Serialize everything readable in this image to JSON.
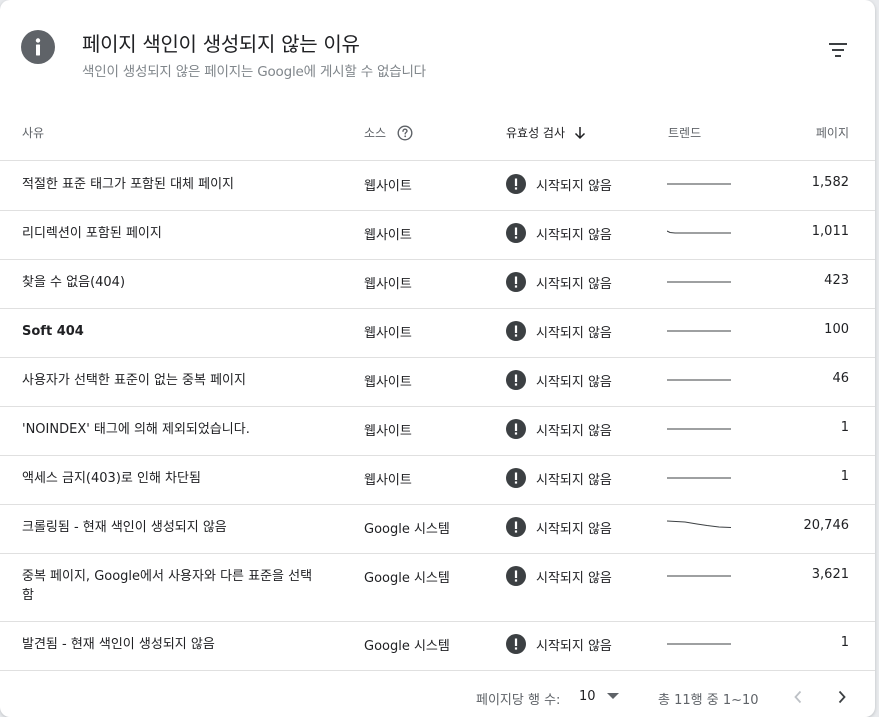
{
  "header": {
    "title": "페이지 색인이 생성되지 않는 이유",
    "subtitle": "색인이 생성되지 않은 페이지는 Google에 게시할 수 없습니다"
  },
  "columns": {
    "reason": "사유",
    "source": "소스",
    "validation": "유효성 검사",
    "trend": "트렌드",
    "pages": "페이지"
  },
  "rows": [
    {
      "reason": "적절한 표준 태그가 포함된 대체 페이지",
      "source": "웹사이트",
      "status": "시작되지 않음",
      "pages": "1,582"
    },
    {
      "reason": "리디렉션이 포함된 페이지",
      "source": "웹사이트",
      "status": "시작되지 않음",
      "pages": "1,011"
    },
    {
      "reason": "찾을 수 없음(404)",
      "source": "웹사이트",
      "status": "시작되지 않음",
      "pages": "423"
    },
    {
      "reason": "Soft 404",
      "source": "웹사이트",
      "status": "시작되지 않음",
      "pages": "100"
    },
    {
      "reason": "사용자가 선택한 표준이 없는 중복 페이지",
      "source": "웹사이트",
      "status": "시작되지 않음",
      "pages": "46"
    },
    {
      "reason": "'NOINDEX' 태그에 의해 제외되었습니다.",
      "source": "웹사이트",
      "status": "시작되지 않음",
      "pages": "1"
    },
    {
      "reason": "액세스 금지(403)로 인해 차단됨",
      "source": "웹사이트",
      "status": "시작되지 않음",
      "pages": "1"
    },
    {
      "reason": "크롤링됨 - 현재 색인이 생성되지 않음",
      "source": "Google 시스템",
      "status": "시작되지 않음",
      "pages": "20,746"
    },
    {
      "reason": "중복 페이지, Google에서 사용자와 다른 표준을 선택함",
      "source": "Google 시스템",
      "status": "시작되지 않음",
      "pages": "3,621"
    },
    {
      "reason": "발견됨 - 현재 색인이 생성되지 않음",
      "source": "Google 시스템",
      "status": "시작되지 않음",
      "pages": "1"
    }
  ],
  "footer": {
    "rows_per_page_label": "페이지당 행 수:",
    "rows_per_page_value": "10",
    "range": "총 11행 중 1~10"
  },
  "icons": {
    "header": "info-icon",
    "filter": "filter-icon",
    "help": "help-icon",
    "sort": "arrow-down-icon",
    "status": "exclamation-icon",
    "prev": "chevron-left-icon",
    "next": "chevron-right-icon"
  },
  "colors": {
    "status_icon": "#3c4043",
    "trend_line": "#3c4043",
    "divider": "#e0e0e0"
  }
}
